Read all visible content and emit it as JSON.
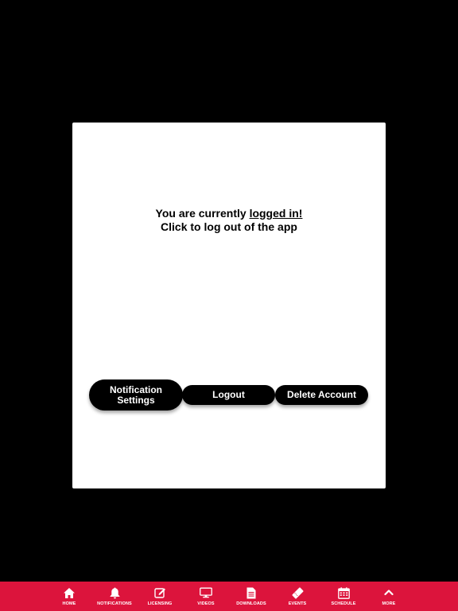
{
  "card": {
    "message_prefix": "You are currently ",
    "message_link": "logged in!",
    "message_line2": "Click to log out of the app"
  },
  "buttons": {
    "notification_settings_line1": "Notification",
    "notification_settings_line2": "Settings",
    "logout": "Logout",
    "delete_account": "Delete Account"
  },
  "tabbar": {
    "background": "#dc143c",
    "items": [
      {
        "label": "HOME",
        "icon": "home-icon"
      },
      {
        "label": "NOTIFICATIONS",
        "icon": "bell-icon"
      },
      {
        "label": "LICENSING",
        "icon": "edit-icon"
      },
      {
        "label": "VIDEOS",
        "icon": "monitor-icon"
      },
      {
        "label": "DOWNLOADS",
        "icon": "document-icon"
      },
      {
        "label": "EVENTS",
        "icon": "ticket-icon"
      },
      {
        "label": "SCHEDULE",
        "icon": "calendar-icon"
      },
      {
        "label": "MORE",
        "icon": "chevron-up-icon"
      }
    ]
  }
}
